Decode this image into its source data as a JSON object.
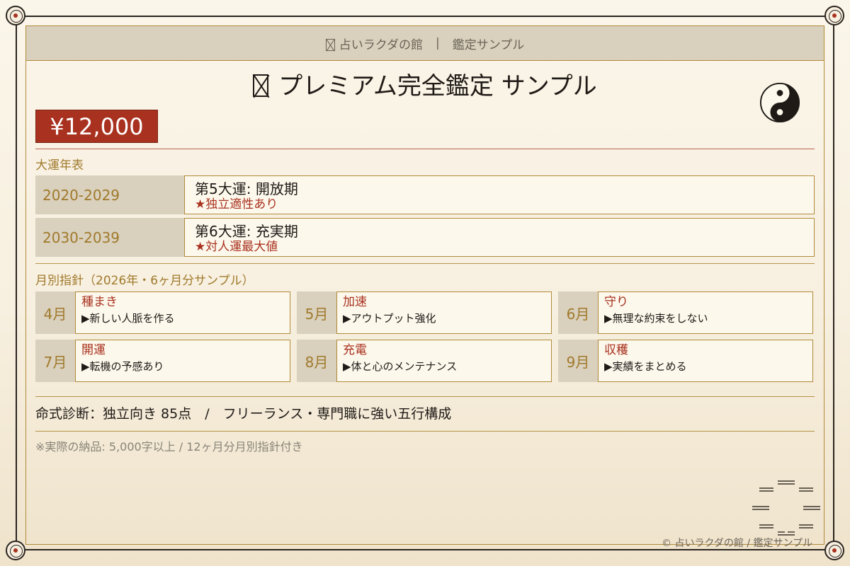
{
  "header": {
    "brand": "占いラクダの館",
    "separator": "|",
    "subtitle": "鑑定サンプル"
  },
  "title": "プレミアム完全鑑定 サンプル",
  "price": "¥12,000",
  "major_luck": {
    "label": "大運年表",
    "rows": [
      {
        "period": "2020-2029",
        "title": "第5大運: 開放期",
        "note": "★独立適性あり"
      },
      {
        "period": "2030-2039",
        "title": "第6大運: 充実期",
        "note": "★対人運最大値"
      }
    ]
  },
  "monthly": {
    "label": "月別指針（2026年・6ヶ月分サンプル）",
    "months": [
      {
        "month": "4月",
        "theme": "種まき",
        "action": "▶新しい人脈を作る"
      },
      {
        "month": "5月",
        "theme": "加速",
        "action": "▶アウトプット強化"
      },
      {
        "month": "6月",
        "theme": "守り",
        "action": "▶無理な約束をしない"
      },
      {
        "month": "7月",
        "theme": "開運",
        "action": "▶転機の予感あり"
      },
      {
        "month": "8月",
        "theme": "充電",
        "action": "▶体と心のメンテナンス"
      },
      {
        "month": "9月",
        "theme": "収穫",
        "action": "▶実績をまとめる"
      }
    ]
  },
  "diagnosis": "命式診断：独立向き 85点　/　フリーランス・専門職に強い五行構成",
  "footnote": "※実際の納品: 5,000字以上 / 12ヶ月分月別指針付き",
  "copyright": "© 占いラクダの館 / 鑑定サンプル",
  "colors": {
    "accent_red": "#a8321f",
    "gold": "#b08a3a",
    "panel_bg": "#d9d0bd",
    "background": "#f7efdf"
  },
  "icons": [
    "box-glyph-icon",
    "yin-yang-icon",
    "trigram-icon",
    "corner-ornament-icon"
  ]
}
